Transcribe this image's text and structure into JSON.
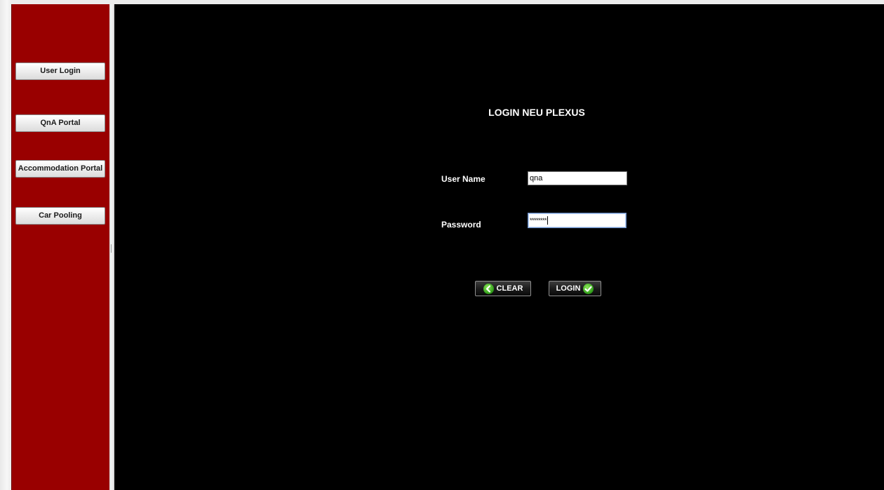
{
  "sidebar": {
    "items": [
      {
        "label": "User Login"
      },
      {
        "label": "QnA Portal"
      },
      {
        "label": "Accommodation Portal"
      },
      {
        "label": "Car Pooling"
      }
    ]
  },
  "form": {
    "title": "LOGIN NEU PLEXUS",
    "username_label": "User Name",
    "username_value": "qna",
    "password_label": "Password",
    "password_value": "********",
    "clear_label": "CLEAR",
    "login_label": "LOGIN"
  },
  "icons": {
    "clear": "green-back-arrow-icon",
    "login": "green-checkmark-icon"
  },
  "colors": {
    "sidebar_bg": "#990000",
    "main_bg": "#000000",
    "accent_green": "#2c9a17"
  }
}
